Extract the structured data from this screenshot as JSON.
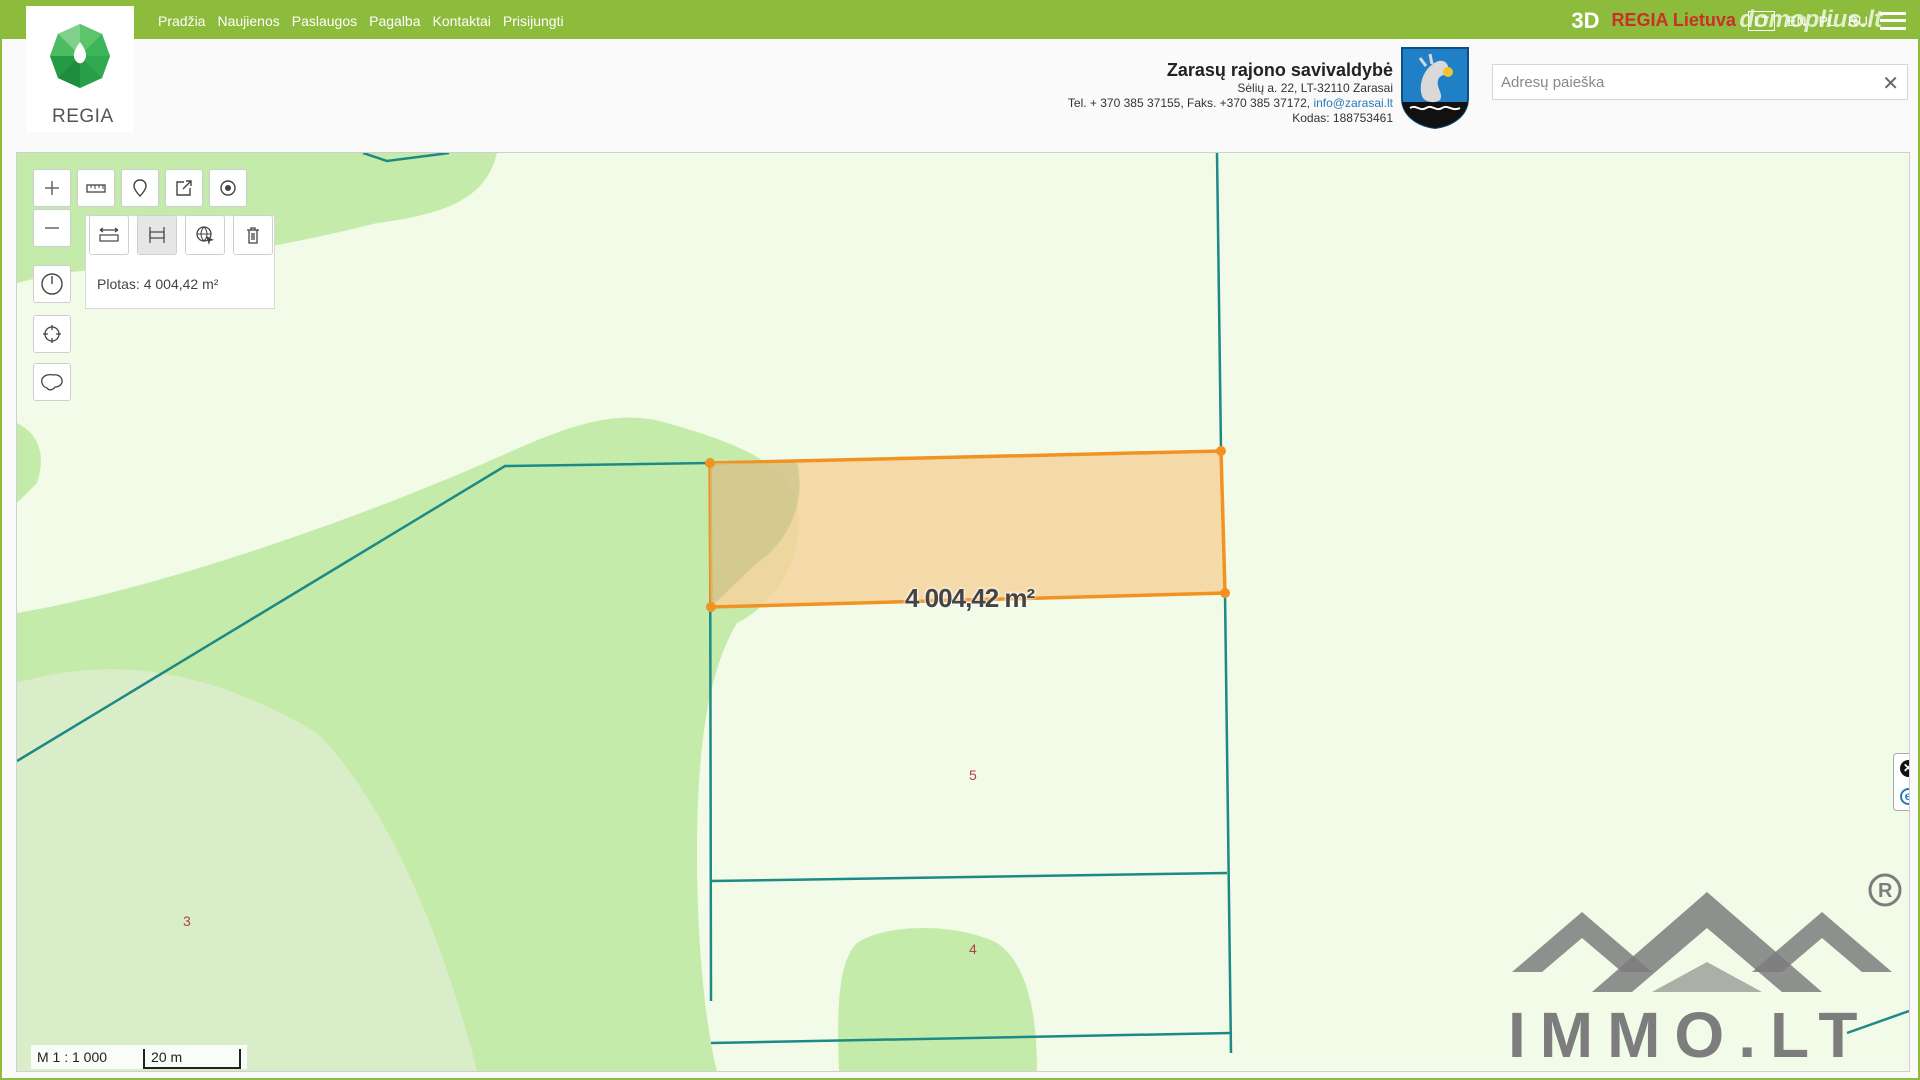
{
  "nav": {
    "items": [
      "Pradžia",
      "Naujienos",
      "Paslaugos",
      "Pagalba",
      "Kontaktai",
      "Prisijungti"
    ]
  },
  "topbar": {
    "mode_3d": "3D",
    "regia_link": "REGIA Lietuva",
    "languages": [
      "LT",
      "EN",
      "PL",
      "RU"
    ],
    "active_language": "LT",
    "watermark": "domoplius.lt"
  },
  "logo": {
    "text": "REGIA"
  },
  "municipality": {
    "name": "Zarasų rajono savivaldybė",
    "address": "Sėlių a. 22, LT-32110 Zarasai",
    "phone_fax": "Tel. + 370 385 37155, Faks. +370 385 37172,",
    "email": "info@zarasai.lt",
    "code": "Kodas: 188753461"
  },
  "search": {
    "placeholder": "Adresų paieška",
    "value": ""
  },
  "measure": {
    "result_text": "Plotas: 4 004,42 m²",
    "map_label": "4 004,42 m²"
  },
  "map": {
    "parcel_numbers": [
      "5",
      "4",
      "3"
    ],
    "scale_ratio": "M 1 : 1 000",
    "scale_length": "20 m"
  },
  "colors": {
    "brand_green": "#8dbb3c",
    "regia_red": "#c8312a",
    "parcel_line": "#1d8a86",
    "measure_stroke": "#f29222",
    "measure_fill": "#f4d49c",
    "forest": "#c5ebaa",
    "meadow": "#f1fbe7"
  },
  "icons": {
    "zoom_in": "plus-icon",
    "zoom_out": "minus-icon",
    "measure_distance": "ruler-icon",
    "location": "pin-icon",
    "share": "share-icon",
    "point": "target-point-icon",
    "measure_line": "ruler-arrows-icon",
    "measure_area": "area-measure-icon",
    "identify": "globe-cursor-icon",
    "delete": "trash-icon",
    "history": "history-icon",
    "locate": "crosshair-icon",
    "lithuania": "lithuania-map-icon"
  }
}
